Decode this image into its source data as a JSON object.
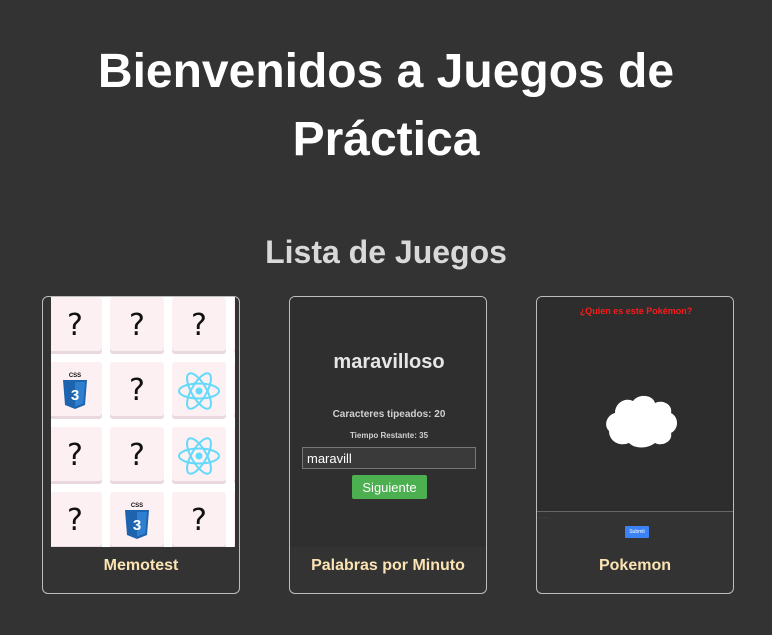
{
  "header": {
    "title_line1": "Bienvenidos a Juegos de",
    "title_line2": "Práctica"
  },
  "section": {
    "title": "Lista de Juegos"
  },
  "games": {
    "memotest": {
      "label": "Memotest",
      "tiles": [
        "?",
        "?",
        "?",
        "?",
        "css3-icon",
        "?",
        "react-icon",
        "?",
        "?",
        "?",
        "react-icon",
        "?",
        "?",
        "css3-icon",
        "?",
        "?"
      ]
    },
    "palabras": {
      "label": "Palabras por Minuto",
      "word": "maravilloso",
      "chars_text": "Caracteres tipeados: 20",
      "time_text": "Tiempo Restante: 35",
      "input_value": "maravill",
      "button_label": "Siguiente"
    },
    "pokemon": {
      "label": "Pokemon",
      "question": "¿Quien es este Pokémon?",
      "submit_label": "Submit"
    }
  },
  "colors": {
    "background": "#333333",
    "card_label": "#fbe3b3",
    "button_green": "#4caf50",
    "question_red": "#ff1a1a"
  }
}
